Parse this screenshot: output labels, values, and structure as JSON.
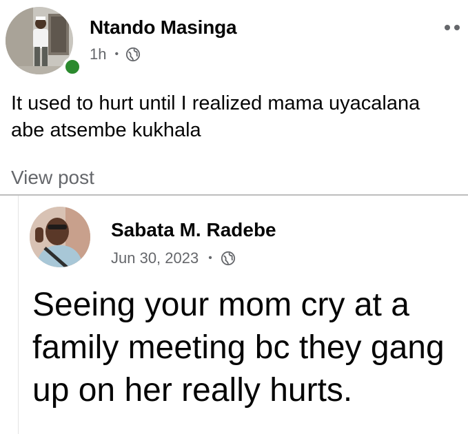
{
  "post": {
    "author": "Ntando Masinga",
    "time": "1h",
    "separator": "•",
    "audience_icon": "globe-icon",
    "text": "It used to hurt until I realized mama uyacalana abe atsembe kukhala",
    "view_post": "View post",
    "online_color": "#2b8a2e"
  },
  "shared_post": {
    "author": "Sabata M. Radebe",
    "date": "Jun 30, 2023",
    "separator": "•",
    "audience_icon": "globe-icon",
    "text": "Seeing your mom cry at a family meeting bc they gang up on her really hurts."
  }
}
